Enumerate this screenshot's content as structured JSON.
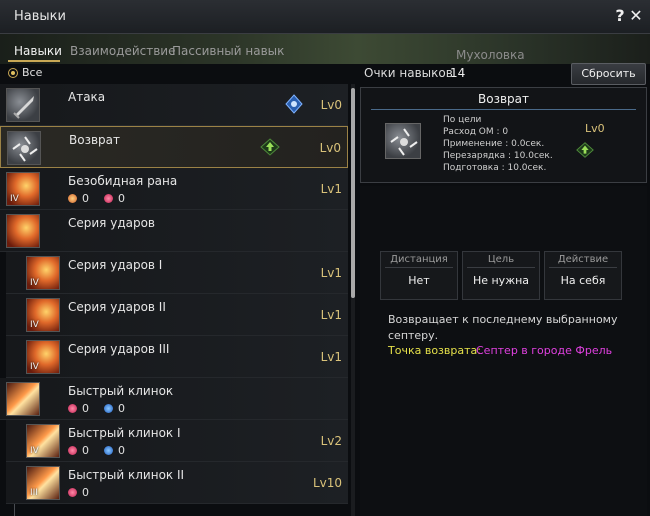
{
  "window": {
    "title": "Навыки"
  },
  "tabs": [
    {
      "label": "Навыки",
      "active": true
    },
    {
      "label": "Взаимодействие",
      "active": false
    },
    {
      "label": "Пассивный навык",
      "active": false
    }
  ],
  "banner_text": "Мухоловка",
  "filter": {
    "label": "Все"
  },
  "skills": [
    {
      "name": "Атака",
      "level": "Lv0",
      "icon": "sword-icon",
      "badge": "blue-gem-icon"
    },
    {
      "name": "Возврат",
      "level": "Lv0",
      "icon": "swirl-icon",
      "badge": "green-arrow-icon",
      "selected": true
    },
    {
      "name": "Безобидная рана",
      "level": "Lv1",
      "icon": "slash-icon",
      "tier": "IV",
      "stats": [
        {
          "type": "orange",
          "value": "0"
        },
        {
          "type": "red",
          "value": "0"
        }
      ]
    },
    {
      "name": "Серия ударов",
      "level": "",
      "icon": "combo-icon"
    },
    {
      "name": "Серия ударов I",
      "level": "Lv1",
      "icon": "combo-icon",
      "tier": "IV",
      "sub": true
    },
    {
      "name": "Серия ударов II",
      "level": "Lv1",
      "icon": "combo-icon",
      "tier": "IV",
      "sub": true
    },
    {
      "name": "Серия ударов III",
      "level": "Lv1",
      "icon": "combo-icon",
      "tier": "IV",
      "sub": true
    },
    {
      "name": "Быстрый клинок",
      "level": "",
      "icon": "blade-icon",
      "stats": [
        {
          "type": "red",
          "value": "0"
        },
        {
          "type": "blue",
          "value": "0"
        }
      ]
    },
    {
      "name": "Быстрый клинок I",
      "level": "Lv2",
      "icon": "blade-icon",
      "tier": "IV",
      "sub": true,
      "stats": [
        {
          "type": "red",
          "value": "0"
        },
        {
          "type": "blue",
          "value": "0"
        }
      ]
    },
    {
      "name": "Быстрый клинок II",
      "level": "Lv10",
      "icon": "blade-icon",
      "tier": "III",
      "sub": true,
      "stats": [
        {
          "type": "red",
          "value": "0"
        }
      ]
    }
  ],
  "skill_points": {
    "label": "Очки навыков",
    "value": "14"
  },
  "reset_label": "Сбросить",
  "detail": {
    "title": "Возврат",
    "lines": [
      "По цели",
      "Расход ОМ : 0",
      "Применение : 0.0сек.",
      "Перезарядка : 10.0сек.",
      "Подготовка : 10.0сек."
    ],
    "level": "Lv0"
  },
  "attributes": [
    {
      "head": "Дистанция",
      "value": "Нет"
    },
    {
      "head": "Цель",
      "value": "Не нужна"
    },
    {
      "head": "Действие",
      "value": "На себя"
    }
  ],
  "description": "Возвращает к последнему выбранному септеру.",
  "return_point": {
    "label": "Точка возврата:",
    "value": "Септер в городе Фрель"
  }
}
